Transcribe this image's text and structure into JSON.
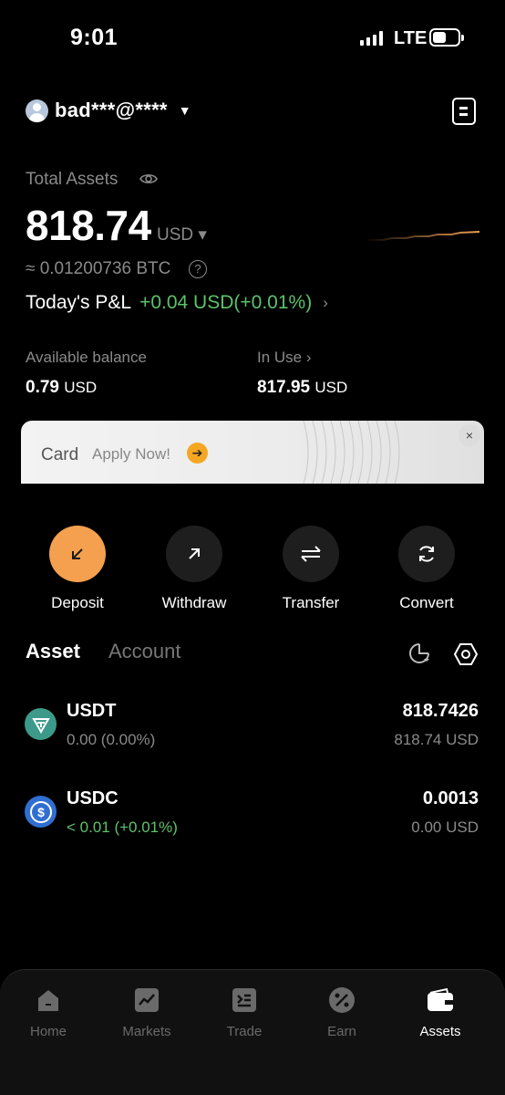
{
  "status_bar": {
    "time": "9:01",
    "network": "LTE"
  },
  "header": {
    "account_name": "bad***@****",
    "caret": "▼"
  },
  "summary": {
    "total_label": "Total Assets",
    "total_value": "818.74",
    "total_currency": "USD ▾",
    "btc_equivalent": "≈ 0.01200736 BTC",
    "pnl_label": "Today's P&L",
    "pnl_value": "+0.04 USD(+0.01%)",
    "pnl_chevron": "›",
    "help_symbol": "?"
  },
  "balances": {
    "available_label": "Available balance",
    "available_amount": "0.79",
    "available_unit": "USD",
    "in_use_label": "In Use ›",
    "in_use_amount": "817.95",
    "in_use_unit": "USD"
  },
  "banner": {
    "card_text": "Card",
    "apply_text": "Apply Now!",
    "arrow": "➔",
    "close": "×"
  },
  "actions": [
    {
      "label": "Deposit"
    },
    {
      "label": "Withdraw"
    },
    {
      "label": "Transfer"
    },
    {
      "label": "Convert"
    }
  ],
  "tabs": {
    "asset": "Asset",
    "account": "Account"
  },
  "assets": [
    {
      "symbol": "USDT",
      "pnl": "0.00 (0.00%)",
      "amount": "818.7426",
      "value": "818.74 USD",
      "icon_color": "#3d9a8b"
    },
    {
      "symbol": "USDC",
      "pnl": "< 0.01 (+0.01%)",
      "amount": "0.0013",
      "value": "0.00 USD",
      "icon_color": "#2f6fd1"
    }
  ],
  "nav": [
    {
      "label": "Home",
      "icon": "home-icon"
    },
    {
      "label": "Markets",
      "icon": "markets-icon"
    },
    {
      "label": "Trade",
      "icon": "trade-icon"
    },
    {
      "label": "Earn",
      "icon": "earn-icon"
    },
    {
      "label": "Assets",
      "icon": "wallet-icon",
      "active": true
    }
  ]
}
